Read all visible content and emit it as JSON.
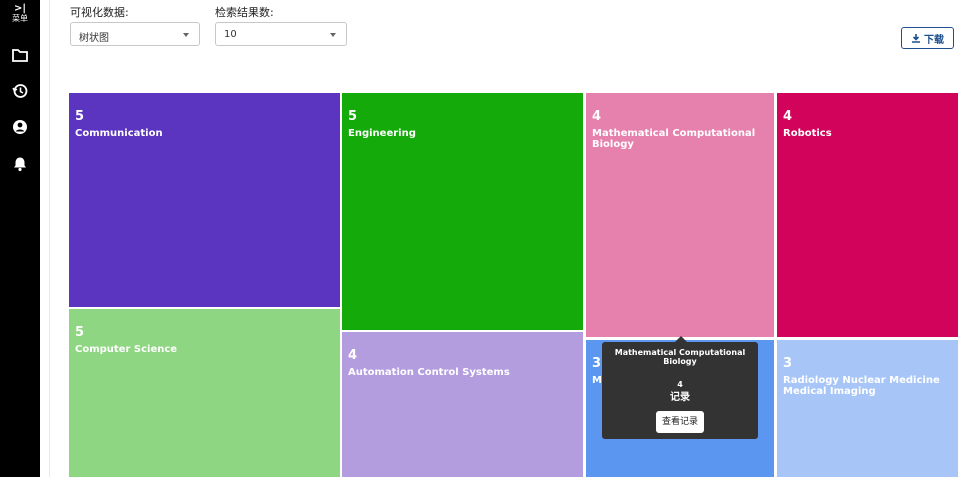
{
  "sidebar": {
    "toggle_glyph": ">|",
    "toggle_label": "菜单",
    "icons": [
      "folder-icon",
      "history-icon",
      "user-circle-icon",
      "bell-icon"
    ]
  },
  "controls": {
    "viz_label": "可视化数据:",
    "viz_value": "树状图",
    "count_label": "检索结果数:",
    "count_value": "10",
    "download_label": "下载"
  },
  "chart_data": {
    "type": "treemap",
    "items": [
      {
        "name": "Communication",
        "value": 5,
        "color": "#5b34c0"
      },
      {
        "name": "Computer Science",
        "value": 5,
        "color": "#8ed681"
      },
      {
        "name": "Engineering",
        "value": 5,
        "color": "#13aa0a"
      },
      {
        "name": "Automation Control Systems",
        "value": 4,
        "color": "#b39ddf"
      },
      {
        "name": "Mathematical Computational Biology",
        "value": 4,
        "color": "#e681ad"
      },
      {
        "name": "Robotics",
        "value": 4,
        "color": "#d2035a"
      },
      {
        "name": "M",
        "value": 3,
        "color": "#5b97f0"
      },
      {
        "name": "Radiology Nuclear Medicine Medical Imaging",
        "value": 3,
        "color": "#a7c6f7"
      }
    ]
  },
  "tooltip": {
    "title": "Mathematical Computational Biology",
    "count": "4",
    "unit": "记录",
    "button": "查看记录"
  }
}
